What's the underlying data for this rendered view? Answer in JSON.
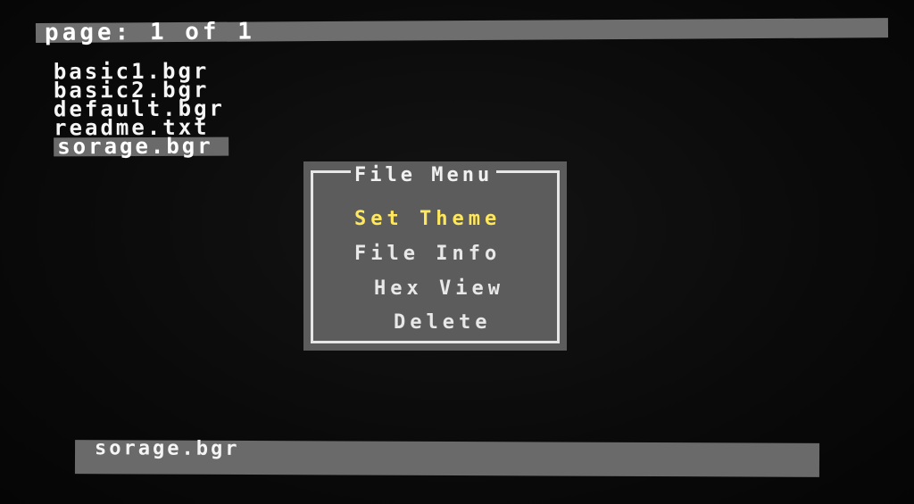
{
  "header": {
    "page_indicator": "page: 1 of 1"
  },
  "files": [
    {
      "name": "basic1.bgr"
    },
    {
      "name": "basic2.bgr"
    },
    {
      "name": "default.bgr"
    },
    {
      "name": "readme.txt"
    },
    {
      "name": "sorage.bgr"
    }
  ],
  "file_menu": {
    "title": "File Menu",
    "items": [
      {
        "label": "Set Theme"
      },
      {
        "label": "File Info"
      },
      {
        "label": "Hex View"
      },
      {
        "label": "Delete"
      }
    ]
  },
  "status": {
    "selected_file": "sorage.bgr"
  },
  "colors": {
    "background": "#0b0b0b",
    "bar": "#6e6e6e",
    "menu_panel": "#5c5c5c",
    "highlight_text": "#ffe85c",
    "text": "#f2f2f2"
  }
}
